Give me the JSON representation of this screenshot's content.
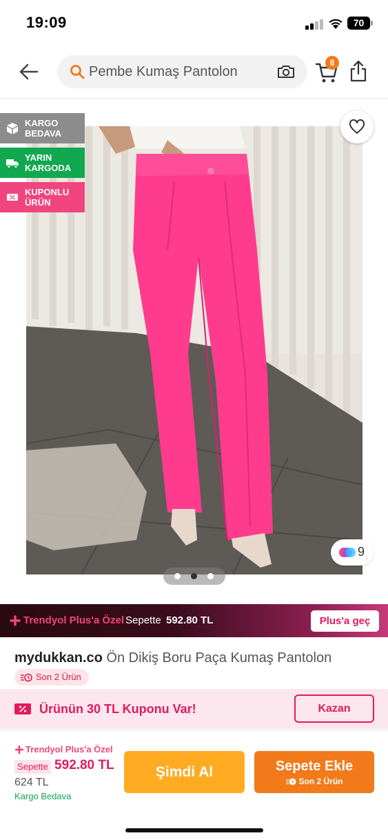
{
  "status_bar": {
    "time": "19:09",
    "battery": "70"
  },
  "nav": {
    "search_text": "Pembe Kumaş Pantolon",
    "cart_count": "8"
  },
  "badges": {
    "kargo": "KARGO BEDAVA",
    "yarin": "YARIN KARGODA",
    "kupon": "KUPONLU ÜRÜN"
  },
  "image": {
    "color_count": "9",
    "page_count": 3,
    "active_page": 2
  },
  "plus_banner": {
    "title": "Trendyol Plus'a Özel",
    "sepette": "Sepette",
    "price": "592.80 TL",
    "button": "Plus'a geç"
  },
  "product": {
    "brand": "mydukkan.co",
    "name": "Ön Dikiş Boru Paça Kumaş Pantolon",
    "stock": "Son 2 Ürün"
  },
  "coupon": {
    "text": "Ürünün 30 TL Kuponu Var!",
    "button": "Kazan"
  },
  "bottom": {
    "plus_label": "Trendyol Plus'a Özel",
    "sepette_tag": "Sepette",
    "plus_price": "592.80 TL",
    "old_price": "624 TL",
    "free_shipping": "Kargo Bedava",
    "buy_now": "Şimdi Al",
    "add_to_cart": "Sepete Ekle",
    "cart_stock": "Son 2 Ürün"
  },
  "colors": {
    "brand_orange": "#f27a1a",
    "buy_yellow": "#ffab21",
    "plus_pink": "#e4195d",
    "green": "#11a84f"
  }
}
